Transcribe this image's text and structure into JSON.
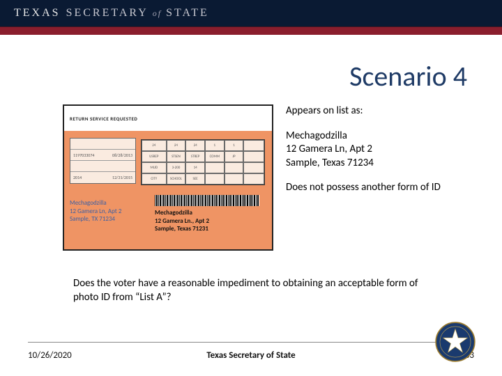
{
  "header": {
    "word1": "TEXAS",
    "word2": "SECRETARY",
    "of": "of",
    "word3": "STATE"
  },
  "title": "Scenario 4",
  "voter_card": {
    "return_line": "RETURN SERVICE REQUESTED",
    "left_block": [
      "",
      "1197033074",
      "",
      "2014"
    ],
    "left_dates": [
      "",
      "08/28/2013",
      "",
      "12/31/2015"
    ],
    "grid_headers": [
      "24",
      "24",
      "24",
      "1",
      "1",
      ""
    ],
    "grid_row2": [
      "USREP",
      "STSEN",
      "STREP",
      "COMM",
      "JP",
      ""
    ],
    "grid_row3": [
      "MUD",
      "3-200",
      "14",
      "",
      "",
      ""
    ],
    "grid_row4": [
      "CITY",
      "SCHOOL",
      "SEE",
      "",
      "",
      ""
    ],
    "addr_blue": [
      "Mechagodzilla",
      "12 Gamera Ln, Apt 2",
      "Sample, TX 71234"
    ],
    "addr_black": [
      "Mechagodzilla",
      "12 Gamera Ln., Apt 2",
      "Sample, Texas 71231"
    ]
  },
  "right_text": {
    "appears_label": "Appears on list as:",
    "name": "Mechagodzilla",
    "addr1": "12 Gamera Ln, Apt 2",
    "addr2": "Sample, Texas 71234",
    "note": "Does not possess another form of ID"
  },
  "question": "Does the voter have a reasonable impediment to obtaining an acceptable form of photo ID from “List A”?",
  "footer": {
    "date": "10/26/2020",
    "center": "Texas Secretary of State",
    "page": "83"
  }
}
